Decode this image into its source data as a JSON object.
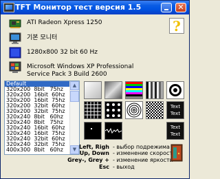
{
  "window": {
    "title": "TFT Монитор тест версия 1.5"
  },
  "info": [
    {
      "icon": "video-card-icon",
      "text": "ATI Radeon Xpress 1250"
    },
    {
      "icon": "monitor-icon",
      "text": "기본 모니터"
    },
    {
      "icon": "display-mode-icon",
      "text": "1280x800 32 bit 60 Hz"
    },
    {
      "icon": "windows-os-icon",
      "text": "Microsoft Windows XP Professional\nService Pack 3 Build 2600"
    }
  ],
  "help_label": "?",
  "modes": [
    "Default",
    "320x200  8bit   75hz",
    "320x200  16bit  60hz",
    "320x200  16bit  75hz",
    "320x200  32bit  60hz",
    "320x200  32bit  75hz",
    "320x240  8bit   60hz",
    "320x240  8bit   75hz",
    "320x240  16bit  60hz",
    "320x240  16bit  75hz",
    "320x240  32bit  60hz",
    "320x240  32bit  75hz",
    "400x300  8bit   60hz"
  ],
  "tests": {
    "text1": "Text\nText",
    "text2": "Text\nText"
  },
  "keys": [
    {
      "label": "Left, Righ",
      "desc": "- выбор подрежима"
    },
    {
      "label": "Up, Down",
      "desc": "- изменение скорости"
    },
    {
      "label": "Grey-, Grey +",
      "desc": "- изменение яркости"
    },
    {
      "label": "Esc",
      "desc": "- выход"
    }
  ]
}
